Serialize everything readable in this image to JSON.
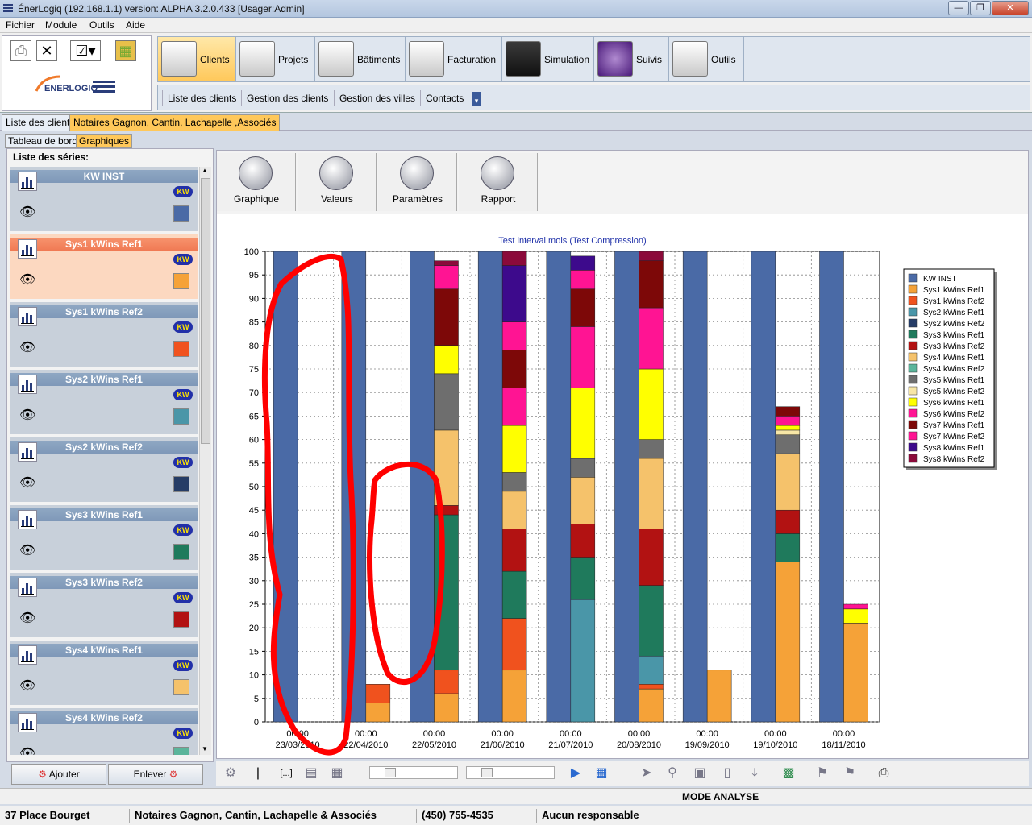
{
  "window": {
    "title": "ÉnerLogiq (192.168.1.1)        version: ALPHA 3.2.0.433    [Usager:Admin]"
  },
  "menu": [
    "Fichier",
    "Module",
    "Outils",
    "Aide"
  ],
  "logo_text": "ENERLOGIQ",
  "modules": [
    {
      "label": "Clients",
      "active": true
    },
    {
      "label": "Projets",
      "active": false
    },
    {
      "label": "Bâtiments",
      "active": false
    },
    {
      "label": "Facturation",
      "active": false
    },
    {
      "label": "Simulation",
      "active": false
    },
    {
      "label": "Suivis",
      "active": false
    },
    {
      "label": "Outils",
      "active": false
    }
  ],
  "subnav": [
    "Liste des clients",
    "Gestion des clients",
    "Gestion des villes",
    "Contacts"
  ],
  "doc_tabs": [
    {
      "label": "Liste des clients",
      "active": false
    },
    {
      "label": "Notaires Gagnon, Cantin, Lachapelle ,Associés",
      "active": true
    }
  ],
  "sub_tabs": [
    {
      "label": "Tableau de bord",
      "active": false
    },
    {
      "label": "Graphiques",
      "active": true
    }
  ],
  "series_panel": {
    "heading": "Liste des séries:",
    "badge": "KW",
    "items": [
      {
        "name": "KW INST",
        "color": "#4a6aa6",
        "selected": false
      },
      {
        "name": "Sys1 kWins Ref1",
        "color": "#f5a238",
        "selected": true
      },
      {
        "name": "Sys1 kWins Ref2",
        "color": "#f0521e",
        "selected": false
      },
      {
        "name": "Sys2 kWins Ref1",
        "color": "#4a96a8",
        "selected": false
      },
      {
        "name": "Sys2 kWins Ref2",
        "color": "#253c66",
        "selected": false
      },
      {
        "name": "Sys3 kWins Ref1",
        "color": "#1f7a5c",
        "selected": false
      },
      {
        "name": "Sys3 kWins Ref2",
        "color": "#b21212",
        "selected": false
      },
      {
        "name": "Sys4 kWins Ref1",
        "color": "#f5c26b",
        "selected": false
      },
      {
        "name": "Sys4 kWins Ref2",
        "color": "#5bb59b",
        "selected": false
      }
    ],
    "add_label": "Ajouter",
    "remove_label": "Enlever"
  },
  "view_tabs": [
    "Graphique",
    "Valeurs",
    "Paramètres",
    "Rapport"
  ],
  "chart_data": {
    "type": "bar",
    "stacked": true,
    "title": "Test interval mois (Test Compression)",
    "xlabel": "",
    "ylabel": "",
    "ylim": [
      0,
      100
    ],
    "yticks": [
      0,
      5,
      10,
      15,
      20,
      25,
      30,
      35,
      40,
      45,
      50,
      55,
      60,
      65,
      70,
      75,
      80,
      85,
      90,
      95,
      100
    ],
    "grid": true,
    "legend_position": "right",
    "categories": [
      "00:00\n23/03/2010",
      "00:00\n22/04/2010",
      "00:00\n22/05/2010",
      "00:00\n21/06/2010",
      "00:00\n21/07/2010",
      "00:00\n20/08/2010",
      "00:00\n19/09/2010",
      "00:00\n19/10/2010",
      "00:00\n18/11/2010"
    ],
    "series": [
      {
        "name": "KW INST",
        "color": "#4a6aa6",
        "values": [
          100,
          100,
          100,
          100,
          100,
          100,
          100,
          100,
          100
        ]
      },
      {
        "name": "Sys1 kWins Ref1",
        "color": "#f5a238",
        "values": [
          0,
          4,
          6,
          11,
          0,
          7,
          11,
          34,
          21
        ]
      },
      {
        "name": "Sys1 kWins Ref2",
        "color": "#f0521e",
        "values": [
          0,
          4,
          5,
          11,
          0,
          1,
          0,
          0,
          0
        ]
      },
      {
        "name": "Sys2 kWins Ref1",
        "color": "#4a96a8",
        "values": [
          0,
          0,
          0,
          0,
          26,
          6,
          0,
          0,
          0
        ]
      },
      {
        "name": "Sys2 kWins Ref2",
        "color": "#253c66",
        "values": [
          0,
          0,
          0,
          0,
          0,
          0,
          0,
          0,
          0
        ]
      },
      {
        "name": "Sys3 kWins Ref1",
        "color": "#1f7a5c",
        "values": [
          0,
          0,
          33,
          10,
          9,
          15,
          0,
          6,
          0
        ]
      },
      {
        "name": "Sys3 kWins Ref2",
        "color": "#b21212",
        "values": [
          0,
          0,
          2,
          9,
          7,
          12,
          0,
          5,
          0
        ]
      },
      {
        "name": "Sys4 kWins Ref1",
        "color": "#f5c26b",
        "values": [
          0,
          0,
          16,
          8,
          10,
          15,
          0,
          12,
          0
        ]
      },
      {
        "name": "Sys4 kWins Ref2",
        "color": "#5bb59b",
        "values": [
          0,
          0,
          0,
          0,
          0,
          0,
          0,
          0,
          0
        ]
      },
      {
        "name": "Sys5 kWins Ref1",
        "color": "#6e6e6e",
        "values": [
          0,
          0,
          12,
          4,
          4,
          4,
          0,
          4,
          0
        ]
      },
      {
        "name": "Sys5 kWins Ref2",
        "color": "#f7e6a6",
        "values": [
          0,
          0,
          0,
          0,
          0,
          0,
          0,
          1,
          0
        ]
      },
      {
        "name": "Sys6 kWins Ref1",
        "color": "#ffff00",
        "values": [
          0,
          0,
          6,
          10,
          15,
          15,
          0,
          1,
          3
        ]
      },
      {
        "name": "Sys6 kWins Ref2",
        "color": "#ff1493",
        "values": [
          0,
          0,
          0,
          8,
          13,
          13,
          0,
          2,
          1
        ]
      },
      {
        "name": "Sys7 kWins Ref1",
        "color": "#7d0808",
        "values": [
          0,
          0,
          12,
          8,
          8,
          10,
          0,
          2,
          0
        ]
      },
      {
        "name": "Sys7 kWins Ref2",
        "color": "#ff1493",
        "values": [
          0,
          0,
          5,
          6,
          4,
          0,
          0,
          0,
          0
        ]
      },
      {
        "name": "Sys8 kWins Ref1",
        "color": "#3d0a8c",
        "values": [
          0,
          0,
          0,
          12,
          3,
          0,
          0,
          0,
          0
        ]
      },
      {
        "name": "Sys8 kWins Ref2",
        "color": "#8b0a3a",
        "values": [
          0,
          0,
          1,
          3,
          0,
          2,
          0,
          0,
          0
        ]
      }
    ]
  },
  "mode": "MODE ANALYSE",
  "status": {
    "address": "37 Place Bourget",
    "client": "Notaires Gagnon, Cantin, Lachapelle & Associés",
    "phone": "(450) 755-4535",
    "responsable": "Aucun responsable"
  }
}
